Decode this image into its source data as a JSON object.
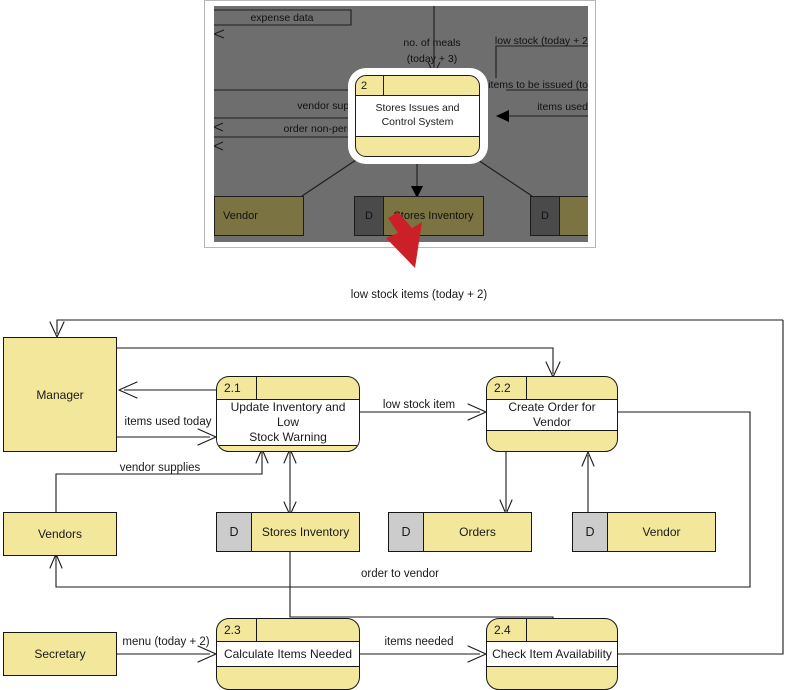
{
  "inset": {
    "name": "context-dfd-thumbnail",
    "process": {
      "number": "2",
      "label": "Stores Issues and\nControl System",
      "line1": "Stores Issues and",
      "line2": "Control System"
    },
    "flows": [
      {
        "label": "expense data"
      },
      {
        "label": "no. of meals",
        "label2": "(today + 3)"
      },
      {
        "label": "low stock (today + 2"
      },
      {
        "label": "items to be issued (to"
      },
      {
        "label": "vendor supplies"
      },
      {
        "label": "items used"
      },
      {
        "label": "order non-perishable"
      }
    ],
    "entities": [
      {
        "label": "Vendor"
      }
    ],
    "stores": [
      {
        "key": "D",
        "label": "Stores Inventory"
      },
      {
        "key": "D",
        "label": ""
      }
    ]
  },
  "zoom_arrow": {
    "name": "red-zoom-arrow",
    "color": "#cc2029"
  },
  "diagram": {
    "title": "",
    "entities": [
      {
        "id": "manager",
        "label": "Manager"
      },
      {
        "id": "vendors",
        "label": "Vendors"
      },
      {
        "id": "secretary",
        "label": "Secretary"
      }
    ],
    "processes": [
      {
        "id": "p21",
        "number": "2.1",
        "label": "Update Inventory and Low Stock Warning",
        "line1": "Update Inventory and Low",
        "line2": "Stock Warning"
      },
      {
        "id": "p22",
        "number": "2.2",
        "label": "Create Order for Vendor",
        "line1": "Create Order for Vendor",
        "line2": ""
      },
      {
        "id": "p23",
        "number": "2.3",
        "label": "Calculate Items Needed",
        "line1": "Calculate Items Needed",
        "line2": ""
      },
      {
        "id": "p24",
        "number": "2.4",
        "label": "Check Item Availability",
        "line1": "Check Item Availability",
        "line2": ""
      }
    ],
    "stores": [
      {
        "id": "ds-stores-inventory",
        "key": "D",
        "label": "Stores Inventory"
      },
      {
        "id": "ds-orders",
        "key": "D",
        "label": "Orders"
      },
      {
        "id": "ds-vendor",
        "key": "D",
        "label": "Vendor"
      }
    ],
    "flows": [
      {
        "id": "f-low-stock-items",
        "label": "low stock items (today + 2)"
      },
      {
        "id": "f-items-used-today",
        "label": "items used today"
      },
      {
        "id": "f-low-stock-item",
        "label": "low stock item"
      },
      {
        "id": "f-vendor-supplies",
        "label": "vendor supplies"
      },
      {
        "id": "f-order-to-vendor",
        "label": "order to vendor"
      },
      {
        "id": "f-menu",
        "label": "menu (today + 2)"
      },
      {
        "id": "f-items-needed",
        "label": "items needed"
      }
    ]
  },
  "colors": {
    "fill_yellow": "#f2e79b",
    "store_key_gray": "#cccccc",
    "stroke": "#171717",
    "overlay_gray": "#6e6e6e",
    "overlay_olive": "#7c7342",
    "red_arrow": "#cc2029"
  }
}
